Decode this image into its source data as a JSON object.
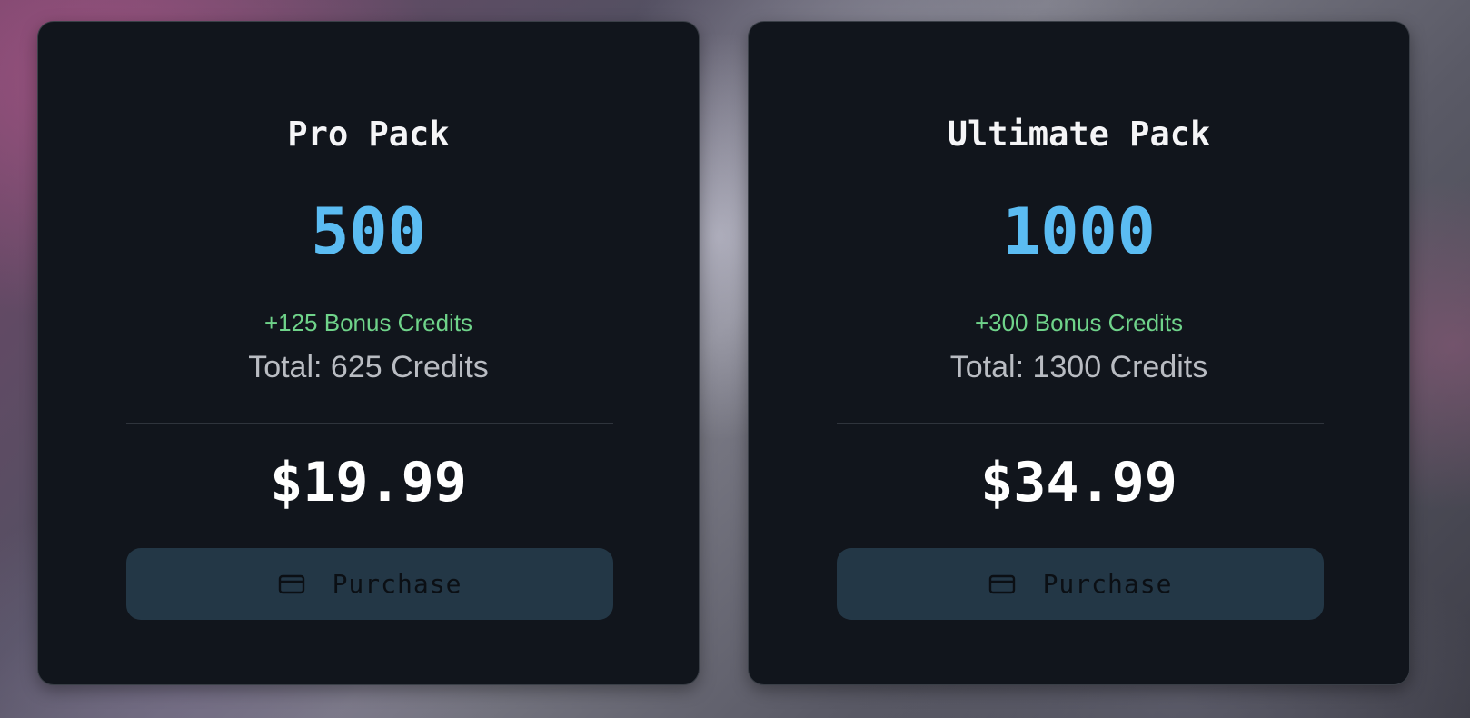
{
  "packs": [
    {
      "title": "Pro Pack",
      "credits": "500",
      "bonus": "+125 Bonus Credits",
      "total": "Total: 625 Credits",
      "price": "$19.99",
      "button_label": "Purchase",
      "button_icon": "credit-card-icon"
    },
    {
      "title": "Ultimate Pack",
      "credits": "1000",
      "bonus": "+300 Bonus Credits",
      "total": "Total: 1300 Credits",
      "price": "$34.99",
      "button_label": "Purchase",
      "button_icon": "credit-card-icon"
    }
  ],
  "colors": {
    "card_background": "#11151c",
    "credits_accent": "#5bbcf2",
    "bonus_green": "#6fd38a",
    "button_background": "#233746"
  }
}
